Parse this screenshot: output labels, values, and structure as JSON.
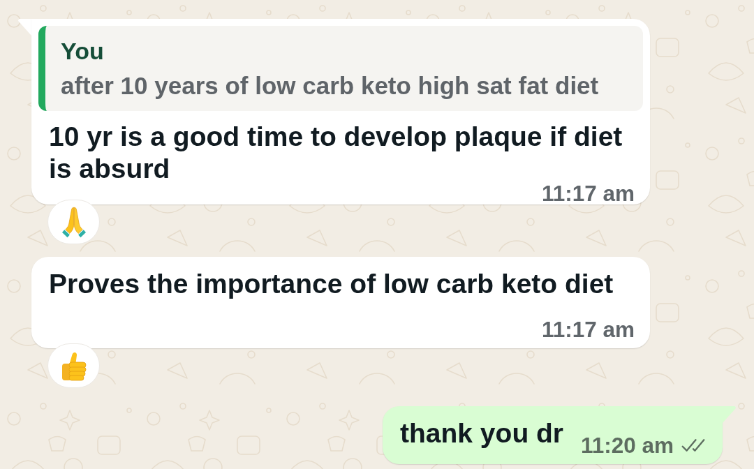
{
  "messages": [
    {
      "kind": "incoming",
      "quote": {
        "author": "You",
        "text": "after 10 years of low carb keto high sat fat diet"
      },
      "text": "10 yr is a good time to develop plaque if diet is absurd",
      "time": "11:17 am",
      "reaction": {
        "kind": "pray"
      }
    },
    {
      "kind": "incoming",
      "text": "Proves the importance of low carb keto diet",
      "time": "11:17 am",
      "reaction": {
        "kind": "thumbs-up"
      }
    },
    {
      "kind": "outgoing",
      "text": "thank you dr",
      "time": "11:20 am",
      "delivered": true,
      "read": false
    }
  ]
}
